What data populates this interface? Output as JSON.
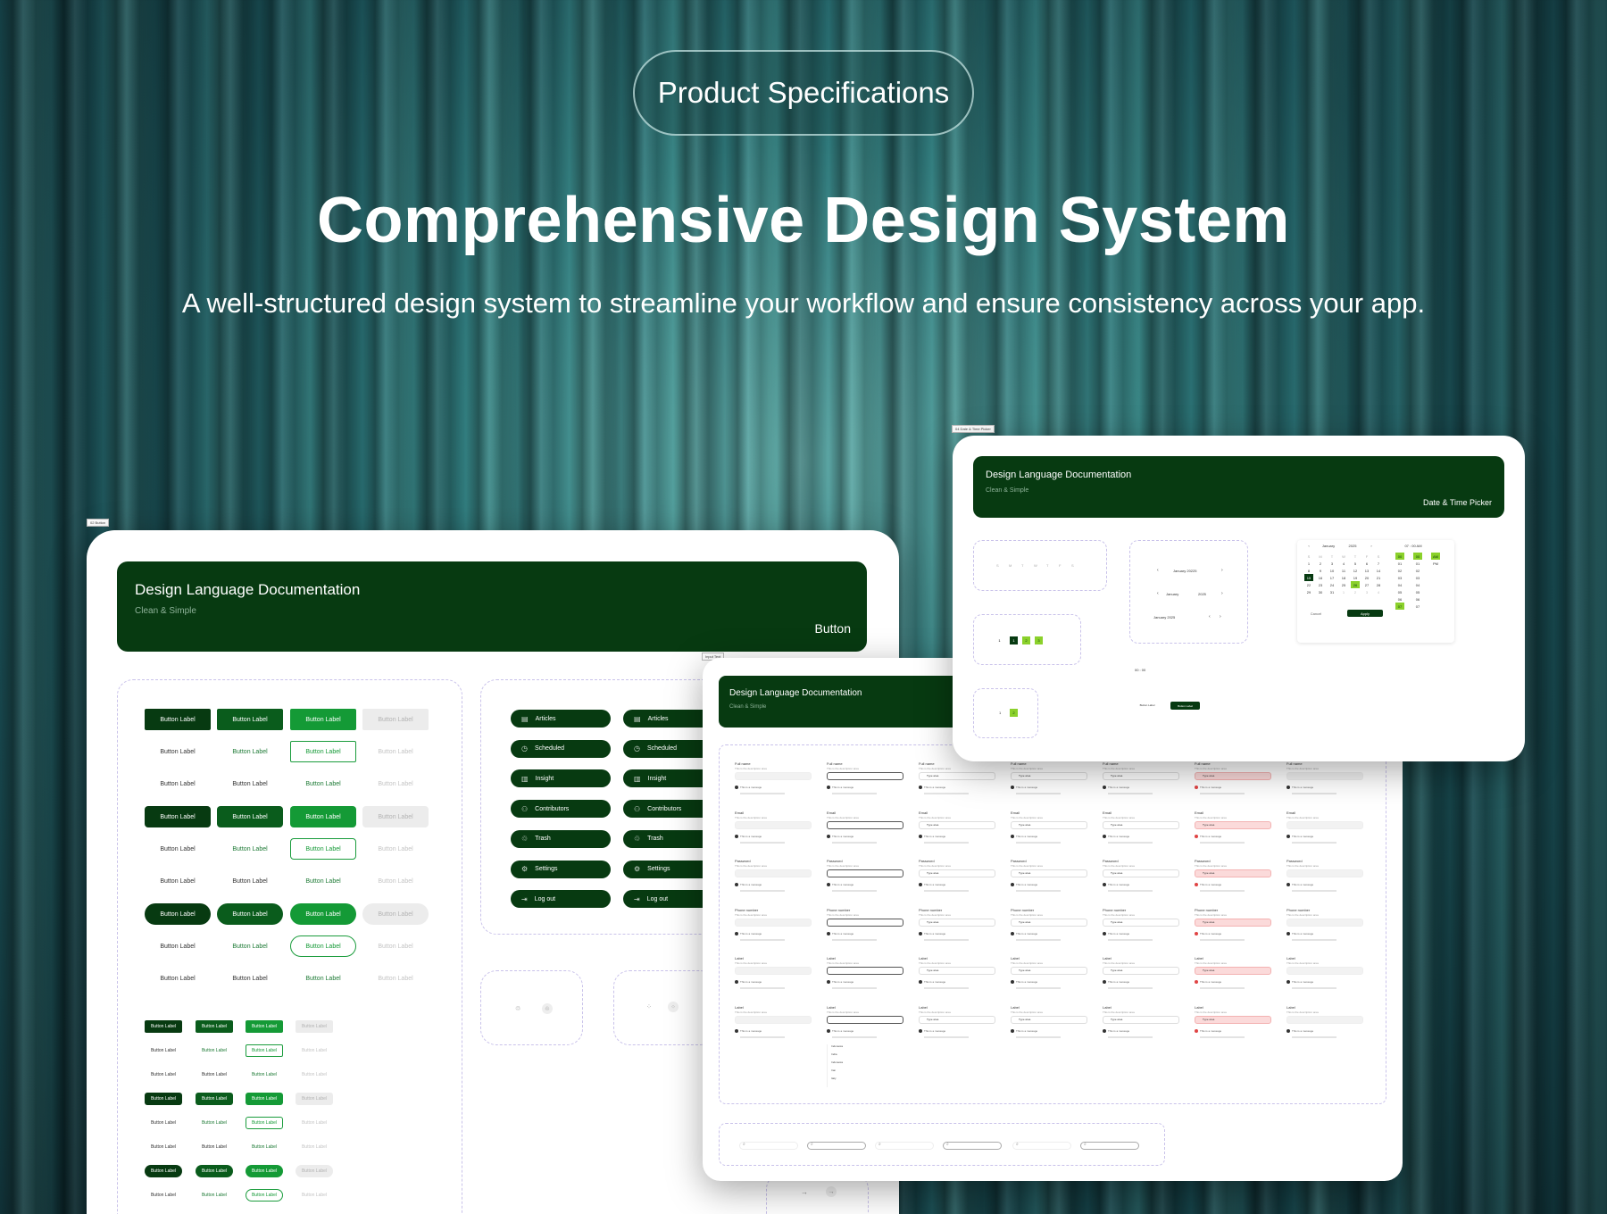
{
  "hero": {
    "pill": "Product Specifications",
    "title": "Comprehensive Design System",
    "subtitle": "A well-structured design system to streamline your workflow and ensure consistency across your app."
  },
  "tags": {
    "left": "02 Button",
    "right": "04 Date & Time Picker",
    "middle": "Input Text"
  },
  "button_card": {
    "banner_title": "Design Language Documentation",
    "banner_subtitle": "Clean & Simple",
    "banner_category": "Button",
    "button_label": "Button Label",
    "nav_items": [
      "Articles",
      "Scheduled",
      "Insight",
      "Contributors",
      "Trash",
      "Settings",
      "Log out"
    ]
  },
  "input_card": {
    "banner_title": "Design Language Documentation",
    "banner_subtitle": "Clean & Simple",
    "field_labels": [
      "Full name",
      "Email",
      "Password",
      "Phone number",
      "Label",
      "Label"
    ],
    "field_hint": "This is the description area",
    "field_value": "Type area",
    "field_message": "This is a message",
    "dropdown_options": [
      "Indonesia",
      "India",
      "Indonesia",
      "Iran",
      "Italy"
    ]
  },
  "date_card": {
    "banner_title": "Design Language Documentation",
    "banner_subtitle": "Clean & Simple",
    "banner_category": "Date & Time Picker",
    "weekdays": [
      "S",
      "M",
      "T",
      "W",
      "T",
      "F",
      "S"
    ],
    "month": "January",
    "year": "2025",
    "header_a": "January 20225",
    "header_b": "January 2025",
    "time_header": "07 : 00 AM",
    "time_display": "00 : 00",
    "hours": [
      "00",
      "01",
      "02",
      "03",
      "04",
      "05",
      "06",
      "07"
    ],
    "minutes": [
      "00",
      "01",
      "02",
      "03",
      "04",
      "05",
      "06",
      "07"
    ],
    "ampm": [
      "AM",
      "PM"
    ],
    "days": [
      "1",
      "2",
      "3",
      "4",
      "5",
      "6",
      "7",
      "8",
      "9",
      "10",
      "11",
      "12",
      "13",
      "14",
      "15",
      "16",
      "17",
      "18",
      "19",
      "20",
      "21",
      "22",
      "23",
      "24",
      "25",
      "26",
      "27",
      "28",
      "29",
      "30",
      "31",
      "1",
      "2",
      "3",
      "4"
    ],
    "cancel": "Cancel",
    "apply": "Apply",
    "btn_ghost": "Button Label",
    "btn_solid": "Button Label",
    "pager": [
      "1",
      "2",
      "3"
    ]
  },
  "colors": {
    "primary": "#073a11",
    "mid": "#0a5c1c",
    "light": "#149a36",
    "lime": "#8bd12b"
  }
}
